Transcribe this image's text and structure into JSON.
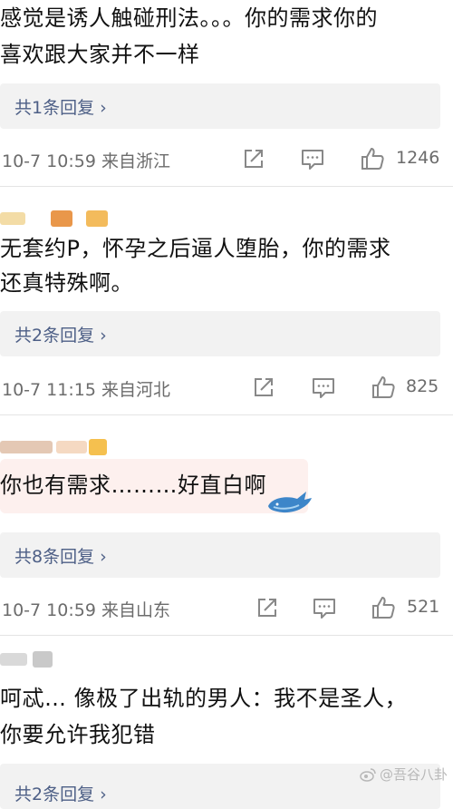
{
  "comments": [
    {
      "text_lines": [
        "感觉是诱人触碰刑法。。。你的需求你的",
        "喜欢跟大家并不一样"
      ],
      "reply_label": "共1条回复 ›",
      "meta": "10-7 10:59  来自浙江",
      "likes": "1246"
    },
    {
      "text_lines": [
        "无套约P，怀孕之后逼人堕胎，你的需求",
        "还真特殊啊。"
      ],
      "reply_label": "共2条回复 ›",
      "meta": "10-7 11:15  来自河北",
      "likes": "825"
    },
    {
      "text_lines": [
        "你也有需求………好直白啊"
      ],
      "reply_label": "共8条回复 ›",
      "meta": "10-7 10:59  来自山东",
      "likes": "521"
    },
    {
      "text_lines": [
        "呵忒… 像极了出轨的男人：我不是圣人，",
        "你要允许我犯错"
      ],
      "reply_label": "共2条回复 ›"
    }
  ],
  "icons": [
    "share-icon",
    "comment-icon",
    "like-icon"
  ],
  "watermark": "@吾谷八卦",
  "colors": {
    "reply_link": "#4d5f86",
    "reply_bg": "#f2f2f2",
    "meta": "#6c6c6c"
  }
}
